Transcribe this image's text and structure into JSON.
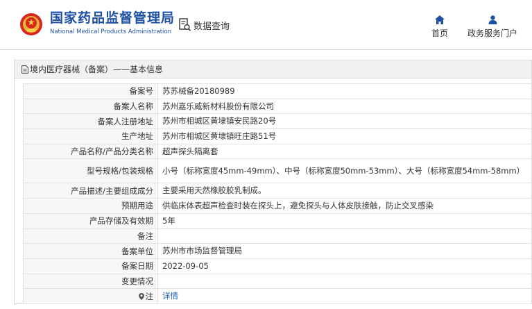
{
  "header": {
    "logo_icon": "national-emblem-icon",
    "brand_cn": "国家药品监督管理局",
    "brand_en": "National Medical Products Administration",
    "query_label": "数据查询",
    "nav": [
      {
        "icon": "home-icon",
        "label": "首页"
      },
      {
        "icon": "user-icon",
        "label": "政务服务门户"
      }
    ]
  },
  "panel": {
    "title": "境内医疗器械（备案）——基本信息",
    "rows": [
      {
        "label": "备案号",
        "value": "苏苏械备20180989"
      },
      {
        "label": "备案人名称",
        "value": "苏州嘉乐威新材料股份有限公司"
      },
      {
        "label": "备案人注册地址",
        "value": "苏州市相城区黄埭镇安民路20号"
      },
      {
        "label": "生产地址",
        "value": "苏州市相城区黄埭镇旺庄路51号"
      },
      {
        "label": "产品名称/产品分类名称",
        "value": "超声探头隔离套"
      },
      {
        "label": "型号规格/包装规格",
        "value": "小号（标称宽度45mm-49mm）、中号（标称宽度50mm-53mm）、大号（标称宽度54mm-58mm）"
      },
      {
        "label": "产品描述/主要组成成分",
        "value": "主要采用天然橡胶胶乳制成。"
      },
      {
        "label": "预期用途",
        "value": "供临床体表超声检查时装在探头上，避免探头与人体皮肤接触，防止交叉感染"
      },
      {
        "label": "产品存储及有效期",
        "value": "5年"
      },
      {
        "label": "备注",
        "value": ""
      },
      {
        "label": "备案单位",
        "value": "苏州市市场监督管理局"
      },
      {
        "label": "备案日期",
        "value": "2022-09-05"
      },
      {
        "label": "变更情况",
        "value": ""
      },
      {
        "label": "注",
        "value": "详情"
      }
    ]
  },
  "colors": {
    "brand_blue": "#1e50a2",
    "link_blue": "#1a5fb4",
    "label_bg": "#f7f7f7",
    "header_bar_bg": "#f1f1f1"
  }
}
